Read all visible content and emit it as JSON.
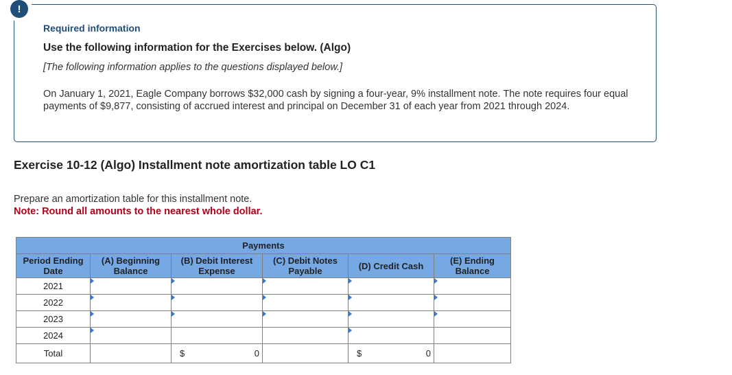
{
  "info_box": {
    "alert_icon": "!",
    "required_label": "Required information",
    "title": "Use the following information for the Exercises below. (Algo)",
    "applies_note": "[The following information applies to the questions displayed below.]",
    "problem_text": "On January 1, 2021, Eagle Company borrows $32,000 cash by signing a four-year, 9% installment note. The note requires four equal payments of $9,877, consisting of accrued interest and principal on December 31 of each year from 2021 through 2024."
  },
  "exercise": {
    "title": "Exercise 10-12 (Algo) Installment note amortization table LO C1",
    "instruction": "Prepare an amortization table for this installment note.",
    "note": "Note: Round all amounts to the nearest whole dollar."
  },
  "table": {
    "group_header": "Payments",
    "columns": {
      "date": "Period Ending Date",
      "a": "(A) Beginning Balance",
      "b": "(B) Debit Interest Expense",
      "c": "(C) Debit Notes Payable",
      "d": "(D) Credit Cash",
      "e": "(E) Ending Balance"
    },
    "rows": [
      {
        "date": "2021",
        "a": "",
        "b": "",
        "c": "",
        "d": "",
        "e": ""
      },
      {
        "date": "2022",
        "a": "",
        "b": "",
        "c": "",
        "d": "",
        "e": ""
      },
      {
        "date": "2023",
        "a": "",
        "b": "",
        "c": "",
        "d": "",
        "e": ""
      },
      {
        "date": "2024",
        "a": "",
        "d": ""
      }
    ],
    "total": {
      "label": "Total",
      "b_currency": "$",
      "b_value": "0",
      "d_currency": "$",
      "d_value": "0"
    }
  },
  "colors": {
    "header_bg": "#76a9e4",
    "input_border": "#4f7bb5",
    "note_red": "#b3001b",
    "info_border": "#1f4e79"
  }
}
